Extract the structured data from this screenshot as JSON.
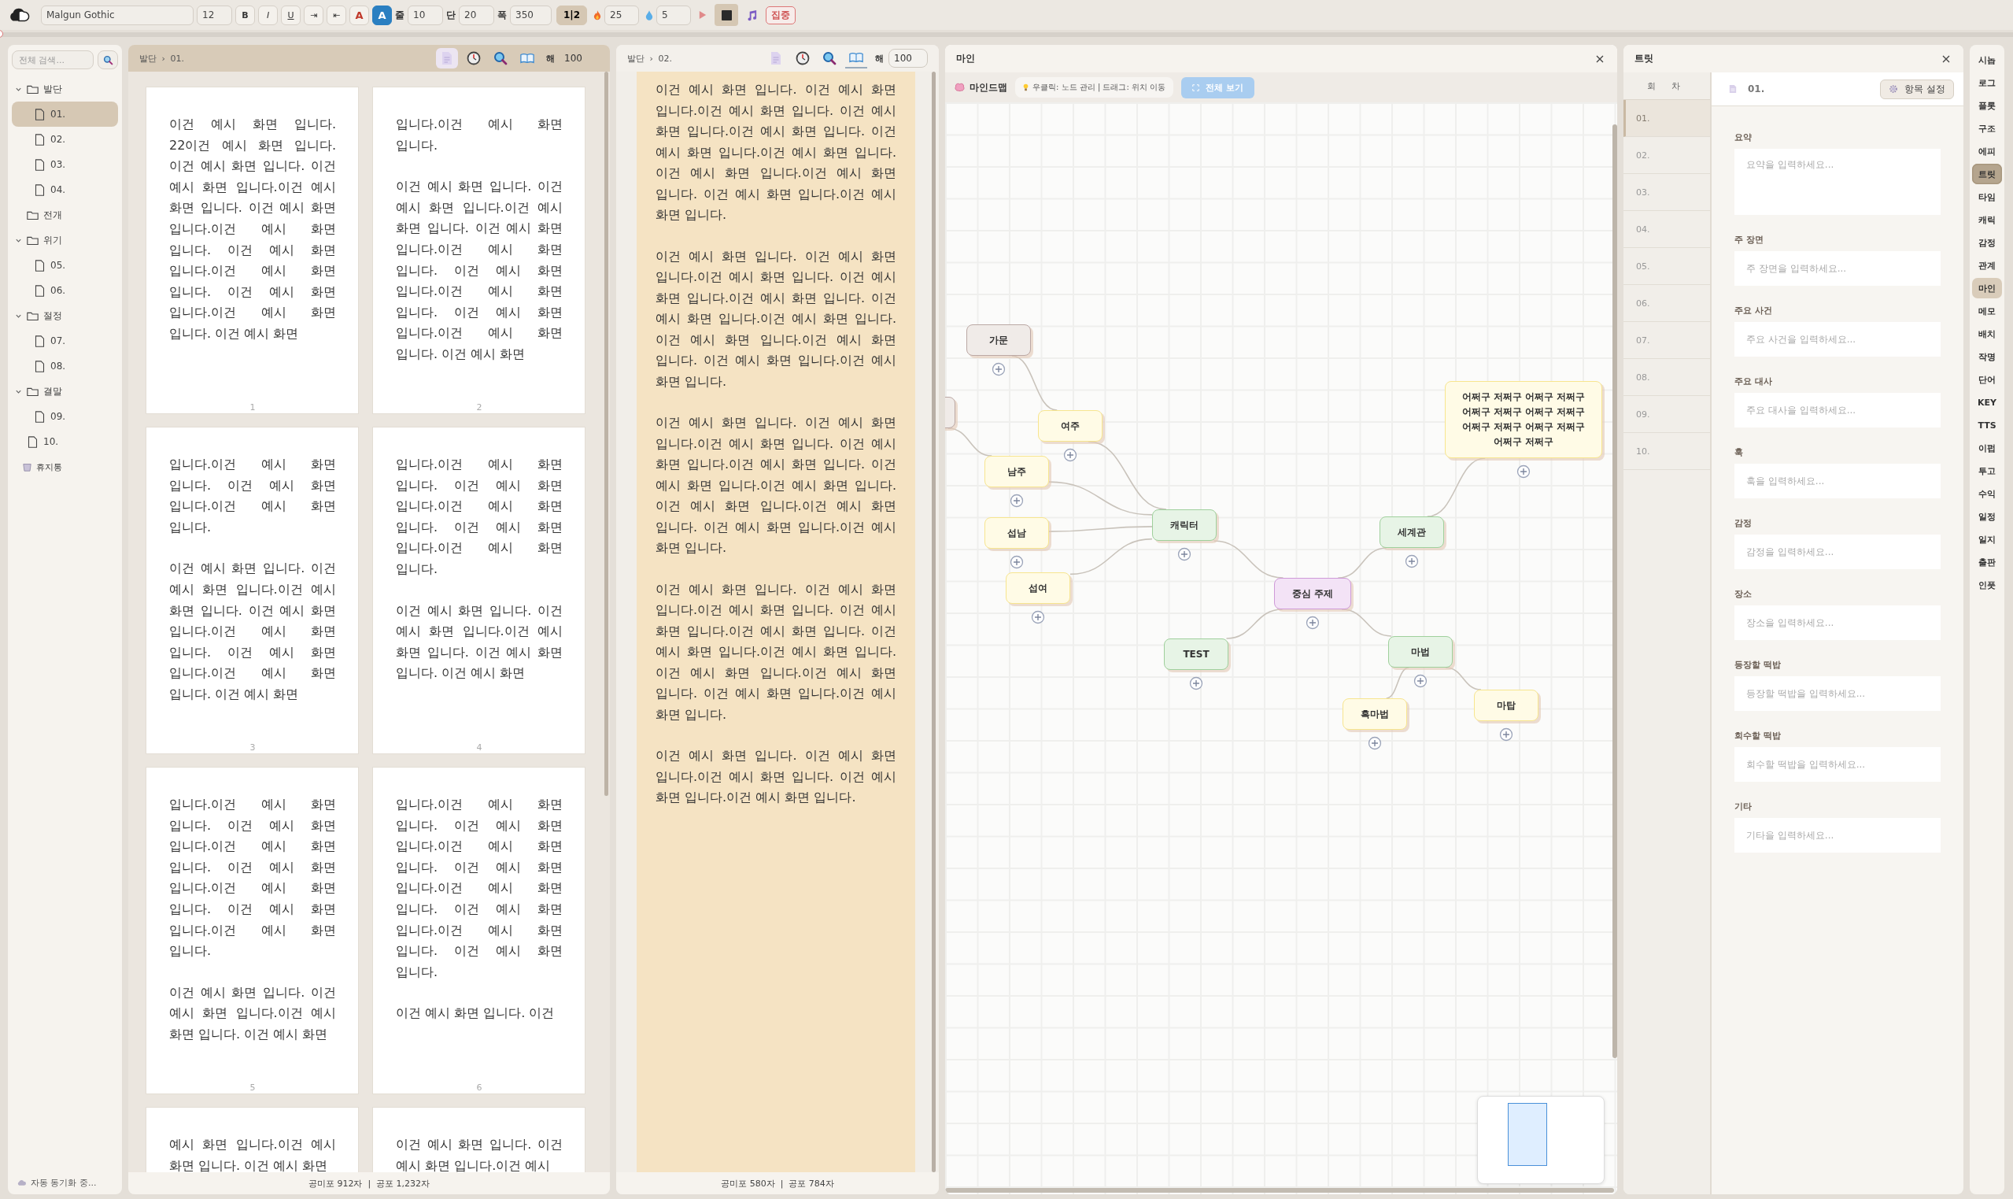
{
  "toolbar": {
    "font": "Malgun Gothic",
    "size": "12",
    "format_buttons": [
      {
        "label": "B",
        "kind": "bold",
        "selected": false
      },
      {
        "label": "I",
        "kind": "italic",
        "selected": false
      },
      {
        "label": "U",
        "kind": "underline",
        "selected": false
      },
      {
        "label": "⇥",
        "kind": "plain",
        "selected": false
      },
      {
        "label": "⇤",
        "kind": "plain",
        "selected": false
      },
      {
        "label": "A",
        "kind": "font-color",
        "selected": false
      },
      {
        "label": "A",
        "kind": "highlight",
        "selected": true
      }
    ],
    "fields": [
      {
        "label": "줄",
        "value": "10"
      },
      {
        "label": "단",
        "value": "20"
      },
      {
        "label": "폭",
        "value": "350"
      }
    ],
    "columns_toggle": {
      "label": "1|2",
      "selected": true
    },
    "goals": [
      {
        "kind": "fire",
        "value": "25"
      },
      {
        "kind": "drop",
        "value": "5"
      }
    ],
    "focus_button": "집중"
  },
  "progress": {
    "level": 0
  },
  "sidebar": {
    "search_placeholder": "전체 검색...",
    "tree": [
      {
        "label": "발단",
        "kind": "folder",
        "selected": false,
        "expanded": true,
        "children": [
          {
            "label": "01.",
            "kind": "doc",
            "selected": true
          },
          {
            "label": "02.",
            "kind": "doc",
            "selected": false
          },
          {
            "label": "03.",
            "kind": "doc",
            "selected": false
          },
          {
            "label": "04.",
            "kind": "doc",
            "selected": false
          }
        ]
      },
      {
        "label": "전개",
        "kind": "folder",
        "selected": false
      },
      {
        "label": "위기",
        "kind": "folder",
        "selected": false,
        "expanded": true,
        "children": [
          {
            "label": "05.",
            "kind": "doc",
            "selected": false
          },
          {
            "label": "06.",
            "kind": "doc",
            "selected": false
          }
        ]
      },
      {
        "label": "절정",
        "kind": "folder",
        "selected": false,
        "expanded": true,
        "children": [
          {
            "label": "07.",
            "kind": "doc",
            "selected": false
          },
          {
            "label": "08.",
            "kind": "doc",
            "selected": false
          }
        ]
      },
      {
        "label": "결말",
        "kind": "folder",
        "selected": false,
        "expanded": true,
        "children": [
          {
            "label": "09.",
            "kind": "doc",
            "selected": false
          }
        ]
      },
      {
        "label": "10.",
        "kind": "doc",
        "selected": false
      }
    ],
    "trash": "휴지통",
    "sync_status": "자동 동기화 중..."
  },
  "pages_panel": {
    "breadcrumb": [
      "발단",
      "01."
    ],
    "separator": "›",
    "tools": [
      {
        "kind": "doc",
        "selected": true
      },
      {
        "kind": "clock",
        "selected": false
      },
      {
        "kind": "search",
        "selected": false
      },
      {
        "kind": "book",
        "selected": false
      }
    ],
    "zoom_label": "해",
    "zoom_value": "100",
    "pages": [
      {
        "number": "1",
        "paragraphs": [
          "이건 예시 화면 입니다. 22이건 예시 화면 입니다.이건 예시 화면 입니다. 이건 예시 화면 입니다.이건 예시 화면 입니다. 이건 예시 화면 입니다.이건 예시 화면 입니다. 이건 예시 화면 입니다.이건 예시 화면 입니다. 이건 예시 화면 입니다.이건 예시 화면 입니다. 이건 예시 화면"
        ]
      },
      {
        "number": "2",
        "paragraphs": [
          "입니다.이건 예시 화면 입니다.",
          "이건 예시 화면 입니다. 이건 예시 화면 입니다.이건 예시 화면 입니다. 이건 예시 화면 입니다.이건 예시 화면 입니다. 이건 예시 화면 입니다.이건 예시 화면 입니다. 이건 예시 화면 입니다.이건 예시 화면 입니다. 이건 예시 화면"
        ]
      },
      {
        "number": "3",
        "paragraphs": [
          "입니다.이건 예시 화면 입니다. 이건 예시 화면 입니다.이건 예시 화면 입니다.",
          "이건 예시 화면 입니다. 이건 예시 화면 입니다.이건 예시 화면 입니다. 이건 예시 화면 입니다.이건 예시 화면 입니다. 이건 예시 화면 입니다.이건 예시 화면 입니다. 이건 예시 화면"
        ]
      },
      {
        "number": "4",
        "paragraphs": [
          "입니다.이건 예시 화면 입니다. 이건 예시 화면 입니다.이건 예시 화면 입니다. 이건 예시 화면 입니다.이건 예시 화면 입니다.",
          "이건 예시 화면 입니다. 이건 예시 화면 입니다.이건 예시 화면 입니다. 이건 예시 화면 입니다. 이건 예시 화면"
        ]
      },
      {
        "number": "5",
        "paragraphs": [
          "입니다.이건 예시 화면 입니다. 이건 예시 화면 입니다.이건 예시 화면 입니다. 이건 예시 화면 입니다.이건 예시 화면 입니다. 이건 예시 화면 입니다.이건 예시 화면 입니다.",
          "이건 예시 화면 입니다. 이건 예시 화면 입니다.이건 예시 화면 입니다. 이건 예시 화면"
        ]
      },
      {
        "number": "6",
        "paragraphs": [
          "입니다.이건 예시 화면 입니다. 이건 예시 화면 입니다.이건 예시 화면 입니다. 이건 예시 화면 입니다.이건 예시 화면 입니다. 이건 예시 화면 입니다.이건 예시 화면 입니다. 이건 예시 화면 입니다.",
          "이건 예시 화면 입니다. 이건"
        ]
      },
      {
        "paragraphs": [
          "예시 화면 입니다.이건 예시 화면 입니다. 이건 예시 화면"
        ]
      },
      {
        "paragraphs": [
          "이건 예시 화면 입니다. 이건 예시 화면 입니다.이건 예시"
        ]
      }
    ],
    "status": "공미포 912자  |  공포 1,232자"
  },
  "editor_panel": {
    "breadcrumb": [
      "발단",
      "02."
    ],
    "separator": "›",
    "tools": [
      {
        "kind": "doc",
        "selected": false
      },
      {
        "kind": "clock",
        "selected": false
      },
      {
        "kind": "search",
        "selected": false
      },
      {
        "kind": "book",
        "selected": true
      }
    ],
    "zoom_label": "해",
    "zoom_value": "100",
    "paragraphs": [
      "이건 예시 화면 입니다. 이건 예시 화면 입니다.이건 예시 화면 입니다. 이건 예시 화면 입니다.이건 예시 화면 입니다. 이건 예시 화면 입니다.이건 예시 화면 입니다. 이건 예시 화면 입니다.이건 예시 화면 입니다. 이건 예시 화면 입니다.이건 예시 화면 입니다.",
      "이건 예시 화면 입니다. 이건 예시 화면 입니다.이건 예시 화면 입니다. 이건 예시 화면 입니다.이건 예시 화면 입니다. 이건 예시 화면 입니다.이건 예시 화면 입니다. 이건 예시 화면 입니다.이건 예시 화면 입니다. 이건 예시 화면 입니다.이건 예시 화면 입니다.",
      "이건 예시 화면 입니다. 이건 예시 화면 입니다.이건 예시 화면 입니다. 이건 예시 화면 입니다.이건 예시 화면 입니다. 이건 예시 화면 입니다.이건 예시 화면 입니다. 이건 예시 화면 입니다.이건 예시 화면 입니다. 이건 예시 화면 입니다.이건 예시 화면 입니다.",
      "이건 예시 화면 입니다. 이건 예시 화면 입니다.이건 예시 화면 입니다. 이건 예시 화면 입니다.이건 예시 화면 입니다. 이건 예시 화면 입니다.이건 예시 화면 입니다. 이건 예시 화면 입니다.이건 예시 화면 입니다. 이건 예시 화면 입니다.이건 예시 화면 입니다.",
      "이건 예시 화면 입니다. 이건 예시 화면 입니다.이건 예시 화면 입니다. 이건 예시 화면 입니다.이건 예시 화면 입니다."
    ],
    "status": "공미포 580자  |  공포 784자"
  },
  "mindmap": {
    "title": "마인",
    "mode": "마인드맵",
    "hint": "우클릭: 노드 관리 | 드래그: 위치 이동",
    "fit_button": "전체 보기",
    "root": {
      "label": "중심 주제",
      "kind": "root",
      "children": [
        {
          "label": "캐릭터",
          "kind": "branch",
          "children": [
            {
              "label": "여주",
              "kind": "leaf",
              "children": [
                {
                  "label": "가문",
                  "kind": "muted"
                }
              ]
            },
            {
              "label": "남주",
              "kind": "leaf",
              "children": [
                {
                  "kind": "muted"
                }
              ]
            },
            {
              "label": "섭남",
              "kind": "leaf"
            },
            {
              "label": "섭여",
              "kind": "leaf"
            }
          ]
        },
        {
          "label": "TEST",
          "kind": "branch"
        },
        {
          "label": "세계관",
          "kind": "branch",
          "children": [
            {
              "label": "어쩌구 저쩌구 어쩌구 저쩌구 어쩌구 저쩌구 어쩌구 저쩌구 어쩌구 저쩌구 어쩌구 저쩌구 어쩌구 저쩌구",
              "kind": "leaf"
            }
          ]
        },
        {
          "label": "마법",
          "kind": "branch",
          "children": [
            {
              "label": "흑마법",
              "kind": "leaf"
            },
            {
              "label": "마탑",
              "kind": "leaf"
            }
          ]
        }
      ]
    }
  },
  "treat": {
    "title": "트릿",
    "list_header": "회 차",
    "episodes": [
      {
        "label": "01.",
        "selected": true
      },
      {
        "label": "02.",
        "selected": false
      },
      {
        "label": "03.",
        "selected": false
      },
      {
        "label": "04.",
        "selected": false
      },
      {
        "label": "05.",
        "selected": false
      },
      {
        "label": "06.",
        "selected": false
      },
      {
        "label": "07.",
        "selected": false
      },
      {
        "label": "08.",
        "selected": false
      },
      {
        "label": "09.",
        "selected": false
      },
      {
        "label": "10.",
        "selected": false
      }
    ],
    "current": "01.",
    "settings_button": "항목 설정",
    "fields": [
      {
        "label": "요약",
        "placeholder": "요약을 입력하세요...",
        "kind": "multiline"
      },
      {
        "label": "주 장면",
        "placeholder": "주 장면을 입력하세요...",
        "kind": "line"
      },
      {
        "label": "주요 사건",
        "placeholder": "주요 사건을 입력하세요...",
        "kind": "line"
      },
      {
        "label": "주요 대사",
        "placeholder": "주요 대사을 입력하세요...",
        "kind": "line"
      },
      {
        "label": "훅",
        "placeholder": "훅을 입력하세요...",
        "kind": "line"
      },
      {
        "label": "감정",
        "placeholder": "감정을 입력하세요...",
        "kind": "line"
      },
      {
        "label": "장소",
        "placeholder": "장소을 입력하세요...",
        "kind": "line"
      },
      {
        "label": "등장할 떡밥",
        "placeholder": "등장할 떡밥을 입력하세요...",
        "kind": "line"
      },
      {
        "label": "회수할 떡밥",
        "placeholder": "회수할 떡밥을 입력하세요...",
        "kind": "line"
      },
      {
        "label": "기타",
        "placeholder": "기타을 입력하세요...",
        "kind": "line"
      }
    ]
  },
  "nav": [
    {
      "label": "시놉",
      "selected": false,
      "focused": false
    },
    {
      "label": "로그",
      "selected": false,
      "focused": false
    },
    {
      "label": "플롯",
      "selected": false,
      "focused": false
    },
    {
      "label": "구조",
      "selected": false,
      "focused": false
    },
    {
      "label": "에피",
      "selected": false,
      "focused": false
    },
    {
      "label": "트릿",
      "selected": true,
      "focused": true
    },
    {
      "label": "타임",
      "selected": false,
      "focused": false
    },
    {
      "label": "캐릭",
      "selected": false,
      "focused": false
    },
    {
      "label": "감정",
      "selected": false,
      "focused": false
    },
    {
      "label": "관계",
      "selected": false,
      "focused": false
    },
    {
      "label": "마인",
      "selected": true,
      "focused": false
    },
    {
      "label": "메모",
      "selected": false,
      "focused": false
    },
    {
      "label": "배치",
      "selected": false,
      "focused": false
    },
    {
      "label": "작명",
      "selected": false,
      "focused": false
    },
    {
      "label": "단어",
      "selected": false,
      "focused": false
    },
    {
      "label": "KEY",
      "selected": false,
      "focused": false
    },
    {
      "label": "TTS",
      "selected": false,
      "focused": false
    },
    {
      "label": "이펍",
      "selected": false,
      "focused": false
    },
    {
      "label": "투고",
      "selected": false,
      "focused": false
    },
    {
      "label": "수익",
      "selected": false,
      "focused": false
    },
    {
      "label": "일정",
      "selected": false,
      "focused": false
    },
    {
      "label": "일지",
      "selected": false,
      "focused": false
    },
    {
      "label": "출판",
      "selected": false,
      "focused": false
    },
    {
      "label": "인풋",
      "selected": false,
      "focused": false
    }
  ]
}
